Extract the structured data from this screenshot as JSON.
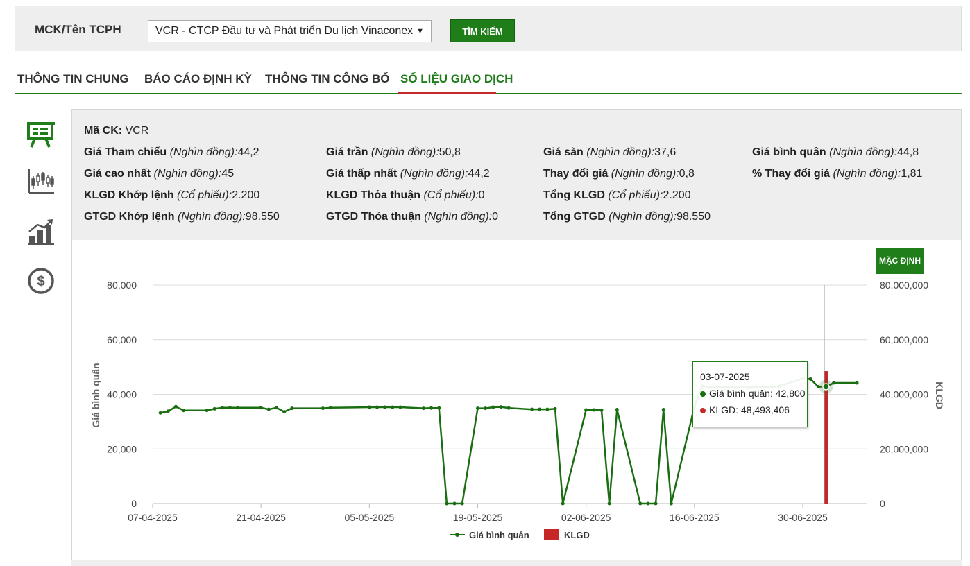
{
  "search": {
    "label": "MCK/Tên TCPH",
    "selected": "VCR - CTCP Đầu tư và Phát triển Du lịch Vinaconex",
    "button": "TÌM KIẾM"
  },
  "tabs": [
    {
      "label": "THÔNG TIN CHUNG"
    },
    {
      "label": "BÁO CÁO ĐỊNH KỲ"
    },
    {
      "label": "THÔNG TIN CÔNG BỐ"
    },
    {
      "label": "SỐ LIỆU GIAO DỊCH"
    }
  ],
  "sidebar_icons": [
    "presentation-board-icon",
    "candlestick-chart-icon",
    "bar-growth-chart-icon",
    "dollar-coin-icon"
  ],
  "info": {
    "ma_ck": {
      "label": "Mã CK:",
      "unit": "",
      "value": "VCR"
    },
    "gia_tham_chieu": {
      "label": "Giá Tham chiếu",
      "unit": "(Nghìn đồng):",
      "value": "44,2"
    },
    "gia_tran": {
      "label": "Giá trần",
      "unit": "(Nghìn đồng):",
      "value": "50,8"
    },
    "gia_san": {
      "label": "Giá sàn",
      "unit": "(Nghìn đồng):",
      "value": "37,6"
    },
    "gia_binh_quan": {
      "label": "Giá bình quân",
      "unit": "(Nghìn đồng):",
      "value": "44,8"
    },
    "gia_cao_nhat": {
      "label": "Giá cao nhất",
      "unit": "(Nghìn đồng):",
      "value": "45"
    },
    "gia_thap_nhat": {
      "label": "Giá thấp nhất",
      "unit": "(Nghìn đồng):",
      "value": "44,2"
    },
    "thay_doi_gia": {
      "label": "Thay đổi giá",
      "unit": "(Nghìn đồng):",
      "value": "0,8"
    },
    "pct_thay_doi_gia": {
      "label": "% Thay đổi giá",
      "unit": "(Nghìn đồng):",
      "value": "1,81"
    },
    "klgd_khop_lenh": {
      "label": "KLGD Khớp lệnh",
      "unit": "(Cổ phiếu):",
      "value": "2.200"
    },
    "klgd_thoa_thuan": {
      "label": "KLGD Thỏa thuận",
      "unit": "(Cổ phiếu):",
      "value": "0"
    },
    "tong_klgd": {
      "label": "Tổng KLGD",
      "unit": "(Cổ phiếu):",
      "value": "2.200"
    },
    "gtgd_khop_lenh": {
      "label": "GTGD Khớp lệnh",
      "unit": "(Nghìn đồng):",
      "value": "98.550"
    },
    "gtgd_thoa_thuan": {
      "label": "GTGD Thỏa thuận",
      "unit": "(Nghìn đồng):",
      "value": "0"
    },
    "tong_gtgd": {
      "label": "Tổng GTGD",
      "unit": "(Nghìn đồng):",
      "value": "98.550"
    }
  },
  "default_button": "MẶC ĐỊNH",
  "tooltip": {
    "date": "03-07-2025",
    "price_label": "Giá bình quân: 42,800",
    "volume_label": "KLGD: 48,493,406"
  },
  "colors": {
    "accent": "#1f7d1a",
    "line": "#1a6e12",
    "volume": "#c62828",
    "active_underline": "#c62828"
  },
  "chart_data": {
    "type": "line",
    "title": "",
    "ylabel": "Giá bình quân",
    "y2label": "KLGD",
    "ylim": [
      0,
      80000
    ],
    "y2lim": [
      0,
      80000000
    ],
    "yticks": [
      "0",
      "20,000",
      "40,000",
      "60,000",
      "80,000"
    ],
    "y2ticks": [
      "0",
      "20,000,000",
      "40,000,000",
      "60,000,000",
      "80,000,000"
    ],
    "xticks": [
      "07-04-2025",
      "21-04-2025",
      "05-05-2025",
      "19-05-2025",
      "02-06-2025",
      "16-06-2025",
      "30-06-2025"
    ],
    "grid": true,
    "legend": "bottom-center",
    "series": [
      {
        "name": "Giá bình quân",
        "kind": "line",
        "x": [
          "2025-04-08",
          "2025-04-09",
          "2025-04-10",
          "2025-04-11",
          "2025-04-14",
          "2025-04-15",
          "2025-04-16",
          "2025-04-17",
          "2025-04-18",
          "2025-04-21",
          "2025-04-22",
          "2025-04-23",
          "2025-04-24",
          "2025-04-25",
          "2025-04-29",
          "2025-04-30",
          "2025-05-05",
          "2025-05-06",
          "2025-05-07",
          "2025-05-08",
          "2025-05-09",
          "2025-05-12",
          "2025-05-13",
          "2025-05-14",
          "2025-05-15",
          "2025-05-16",
          "2025-05-17",
          "2025-05-19",
          "2025-05-20",
          "2025-05-21",
          "2025-05-22",
          "2025-05-23",
          "2025-05-26",
          "2025-05-27",
          "2025-05-28",
          "2025-05-29",
          "2025-05-30",
          "2025-06-02",
          "2025-06-03",
          "2025-06-04",
          "2025-06-05",
          "2025-06-06",
          "2025-06-09",
          "2025-06-10",
          "2025-06-11",
          "2025-06-12",
          "2025-06-13",
          "2025-06-16",
          "2025-06-17",
          "2025-06-18",
          "2025-06-19",
          "2025-06-20",
          "2025-06-23",
          "2025-06-24",
          "2025-06-25",
          "2025-06-26",
          "2025-06-27",
          "2025-06-30",
          "2025-07-01",
          "2025-07-02",
          "2025-07-03",
          "2025-07-04",
          "2025-07-07"
        ],
        "values": [
          33200,
          33800,
          35500,
          34100,
          34100,
          34700,
          35100,
          35100,
          35100,
          35100,
          34500,
          35100,
          33600,
          34900,
          34900,
          35100,
          35300,
          35300,
          35300,
          35300,
          35300,
          34900,
          35000,
          35000,
          0,
          0,
          0,
          34900,
          34900,
          35300,
          35400,
          35000,
          34500,
          34500,
          34500,
          34700,
          0,
          34300,
          34300,
          34200,
          0,
          34400,
          0,
          0,
          0,
          34400,
          0,
          35500,
          43000,
          42500,
          42600,
          42600,
          42500,
          42700,
          42700,
          42700,
          43000,
          45800,
          45600,
          42800,
          42800,
          44200,
          44200
        ]
      },
      {
        "name": "KLGD",
        "kind": "bar",
        "x": [
          "2025-07-03"
        ],
        "values": [
          48493406
        ]
      }
    ]
  }
}
